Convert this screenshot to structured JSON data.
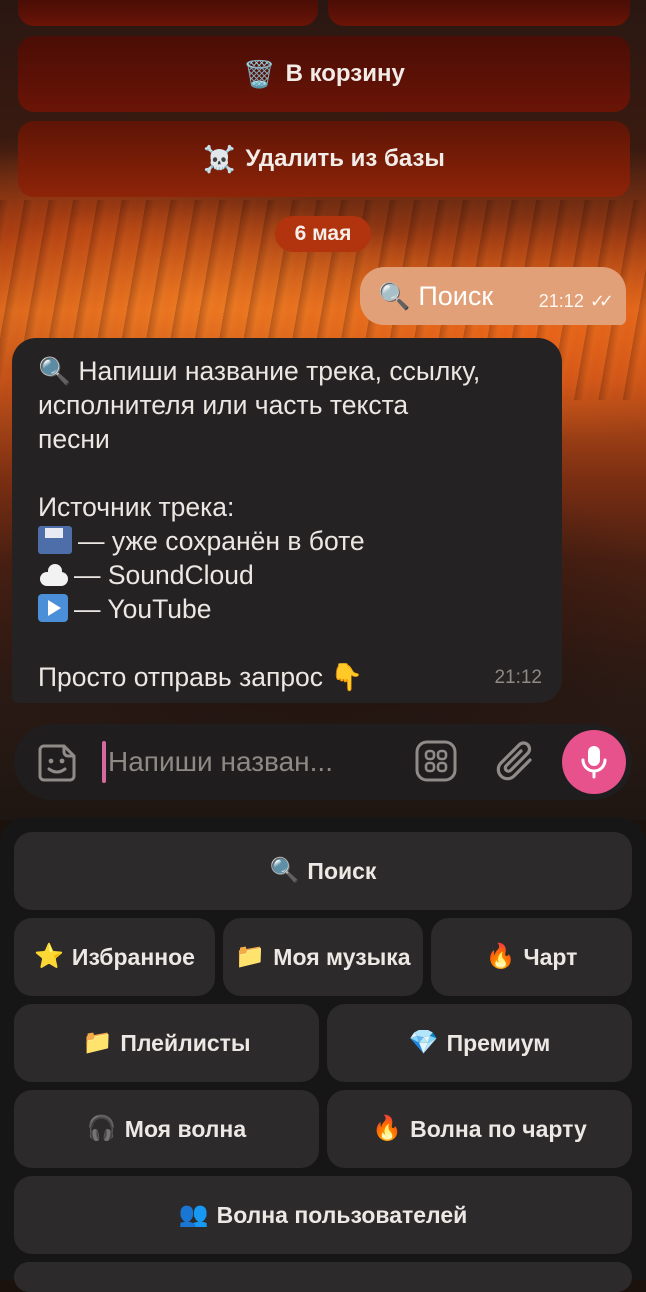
{
  "chat": {
    "top_buttons": [
      {
        "emoji": "🗑️",
        "label": "В корзину"
      },
      {
        "emoji": "☠️",
        "label": "Удалить из базы"
      }
    ],
    "date_pill": "6 мая",
    "outgoing": {
      "emoji": "🔍",
      "text": "Поиск",
      "time": "21:12",
      "status": "read"
    },
    "incoming": {
      "lines": [
        "Напиши название трека, ссылку,",
        "исполнителя или часть текста",
        "песни",
        "",
        "Источник трека:"
      ],
      "sources": [
        {
          "icon": "floppy-disk-icon",
          "text": "— уже сохранён в боте"
        },
        {
          "icon": "cloud-icon",
          "text": "— SoundCloud"
        },
        {
          "icon": "play-button-icon",
          "text": "— YouTube"
        }
      ],
      "footer": "Просто отправь запрос",
      "footer_emoji": "👇",
      "time": "21:12",
      "lead_emoji": "🔍"
    }
  },
  "input_bar": {
    "placeholder": "Напиши назван..."
  },
  "keyboard": {
    "rows": [
      [
        {
          "emoji": "🔍",
          "label": "Поиск"
        }
      ],
      [
        {
          "emoji": "⭐",
          "label": "Избранное"
        },
        {
          "emoji": "📁",
          "label": "Моя музыка"
        },
        {
          "emoji": "🔥",
          "label": "Чарт"
        }
      ],
      [
        {
          "emoji": "📁",
          "label": "Плейлисты"
        },
        {
          "emoji": "💎",
          "label": "Премиум"
        }
      ],
      [
        {
          "emoji": "🎧",
          "label": "Моя волна"
        },
        {
          "emoji": "🔥",
          "label": "Волна по чарту"
        }
      ],
      [
        {
          "emoji": "👥",
          "label": "Волна пользователей"
        }
      ]
    ]
  },
  "colors": {
    "accent_mic": "#e7528c",
    "bot_button": "#6a1406",
    "date_pill": "#b1340e",
    "outgoing_bubble": "#e1a078",
    "incoming_bubble": "#242222"
  }
}
